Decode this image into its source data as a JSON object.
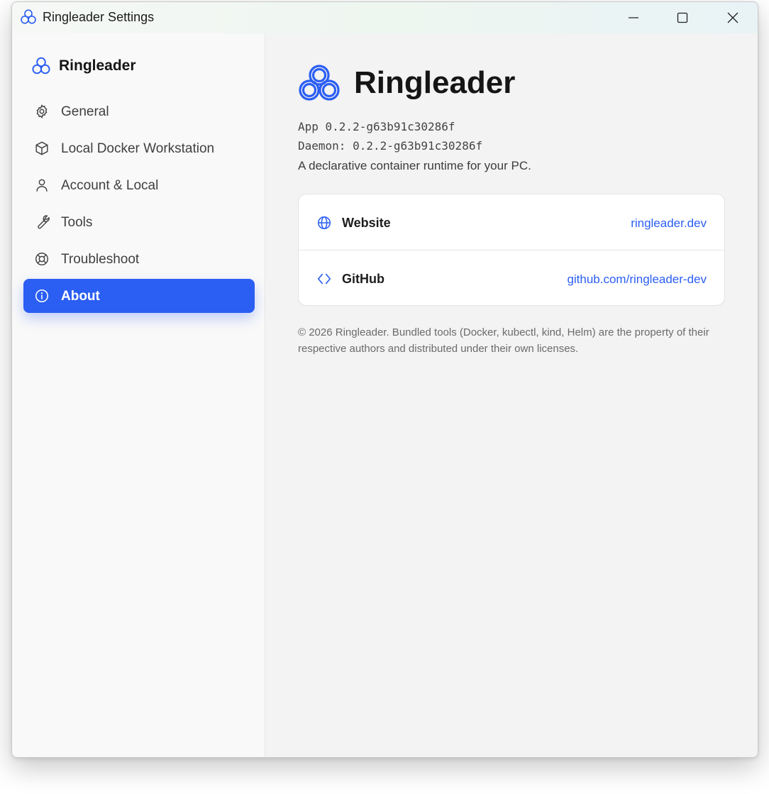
{
  "window": {
    "title": "Ringleader Settings",
    "controls": {
      "minimize_icon": "minimize-icon",
      "maximize_icon": "maximize-icon",
      "close_icon": "close-icon"
    }
  },
  "sidebar": {
    "brand": "Ringleader",
    "items": [
      {
        "label": "General",
        "icon": "gear-icon",
        "active": false
      },
      {
        "label": "Local Docker Workstation",
        "icon": "cube-icon",
        "active": false
      },
      {
        "label": "Account & Local",
        "icon": "user-icon",
        "active": false
      },
      {
        "label": "Tools",
        "icon": "wrench-icon",
        "active": false
      },
      {
        "label": "Troubleshoot",
        "icon": "lifebuoy-icon",
        "active": false
      },
      {
        "label": "About",
        "icon": "info-icon",
        "active": true
      }
    ]
  },
  "about": {
    "title": "Ringleader",
    "app_version": "App 0.2.2-g63b91c30286f",
    "daemon_version": "Daemon: 0.2.2-g63b91c30286f",
    "description": "A declarative container runtime for your PC.",
    "links": [
      {
        "name": "Website",
        "icon": "globe-icon",
        "value": "ringleader.dev"
      },
      {
        "name": "GitHub",
        "icon": "code-icon",
        "value": "github.com/ringleader-dev"
      }
    ],
    "legal": "© 2026 Ringleader. Bundled tools (Docker, kubectl, kind, Helm) are the property of their respective authors and distributed under their own licenses."
  },
  "colors": {
    "accent": "#2b5ef3",
    "sidebar_bg": "#f9f9f9",
    "content_bg": "#f3f3f3",
    "card_bg": "#ffffff"
  }
}
